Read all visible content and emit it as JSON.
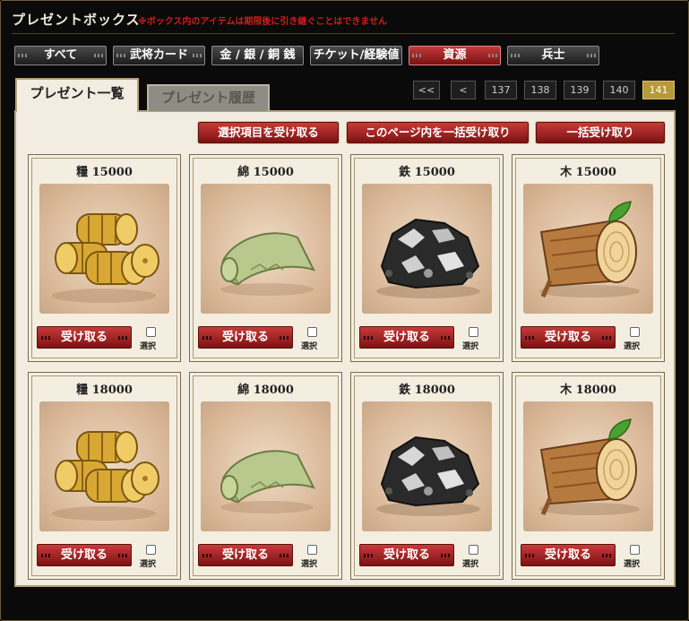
{
  "header": {
    "title": "プレゼントボックス",
    "warning": "※ボックス内のアイテムは期限後に引き継ぐことはできません"
  },
  "filter_tabs": [
    {
      "label": "すべて",
      "active": false
    },
    {
      "label": "武将カード",
      "active": false
    },
    {
      "label": "金 / 銀 / 銅 銭",
      "active": false
    },
    {
      "label": "チケット/経験値",
      "active": false
    },
    {
      "label": "資源",
      "active": true
    },
    {
      "label": "兵士",
      "active": false
    }
  ],
  "panel_tabs": {
    "list": "プレゼント一覧",
    "history": "プレゼント履歴"
  },
  "pagination": {
    "first": "<<",
    "prev": "<",
    "pages": [
      "137",
      "138",
      "139",
      "140",
      "141"
    ],
    "current": "141"
  },
  "actions": {
    "receive_selected": "選択項目を受け取る",
    "receive_page": "このページ内を一括受け取り",
    "receive_all": "一括受け取り"
  },
  "items": [
    {
      "name": "糧 15000",
      "icon": "grain-bales-icon",
      "button": "受け取る",
      "select": "選択"
    },
    {
      "name": "綿 15000",
      "icon": "cotton-cloth-icon",
      "button": "受け取る",
      "select": "選択"
    },
    {
      "name": "鉄 15000",
      "icon": "iron-ore-icon",
      "button": "受け取る",
      "select": "選択"
    },
    {
      "name": "木 15000",
      "icon": "wood-log-icon",
      "button": "受け取る",
      "select": "選択"
    },
    {
      "name": "糧 18000",
      "icon": "grain-bales-icon",
      "button": "受け取る",
      "select": "選択"
    },
    {
      "name": "綿 18000",
      "icon": "cotton-cloth-icon",
      "button": "受け取る",
      "select": "選択"
    },
    {
      "name": "鉄 18000",
      "icon": "iron-ore-icon",
      "button": "受け取る",
      "select": "選択"
    },
    {
      "name": "木 18000",
      "icon": "wood-log-icon",
      "button": "受け取る",
      "select": "選択"
    }
  ],
  "colors": {
    "accent_red": "#b02424",
    "panel_bg": "#f2ede0",
    "page_current": "#b89a3a"
  }
}
